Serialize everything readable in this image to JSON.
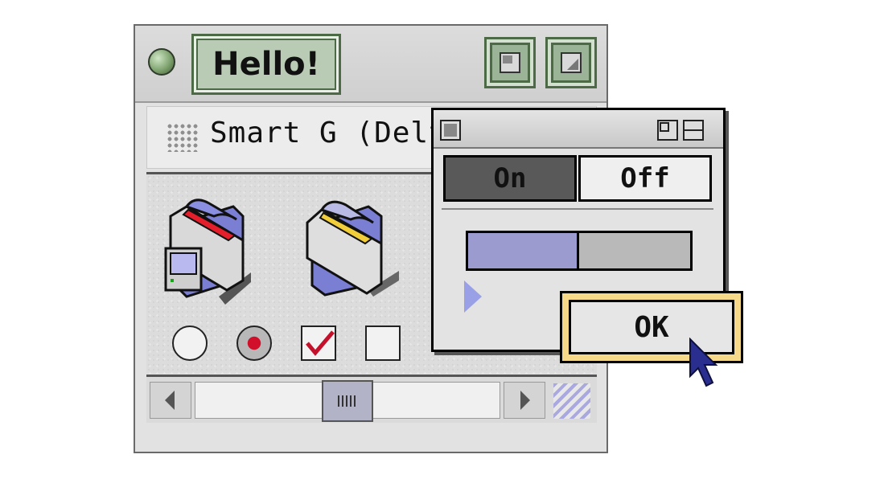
{
  "main_window": {
    "title": "Hello!",
    "path_label": "Smart G (Delt",
    "icons": [
      "disk-folder-icon",
      "folder-icon"
    ],
    "controls": {
      "radio_unselected": false,
      "radio_selected": true,
      "checkbox_checked": true,
      "checkbox_unchecked": false
    },
    "scroll_position": 0.52
  },
  "dialog": {
    "segment": {
      "on_label": "On",
      "off_label": "Off",
      "selected": "On"
    },
    "progress": 0.5,
    "ok_label": "OK"
  },
  "colors": {
    "title_accent": "#b9cbb4",
    "progress_fill": "#9b9bd0",
    "default_button_ring": "#f7d98a",
    "radio_dot": "#d10f2a"
  }
}
